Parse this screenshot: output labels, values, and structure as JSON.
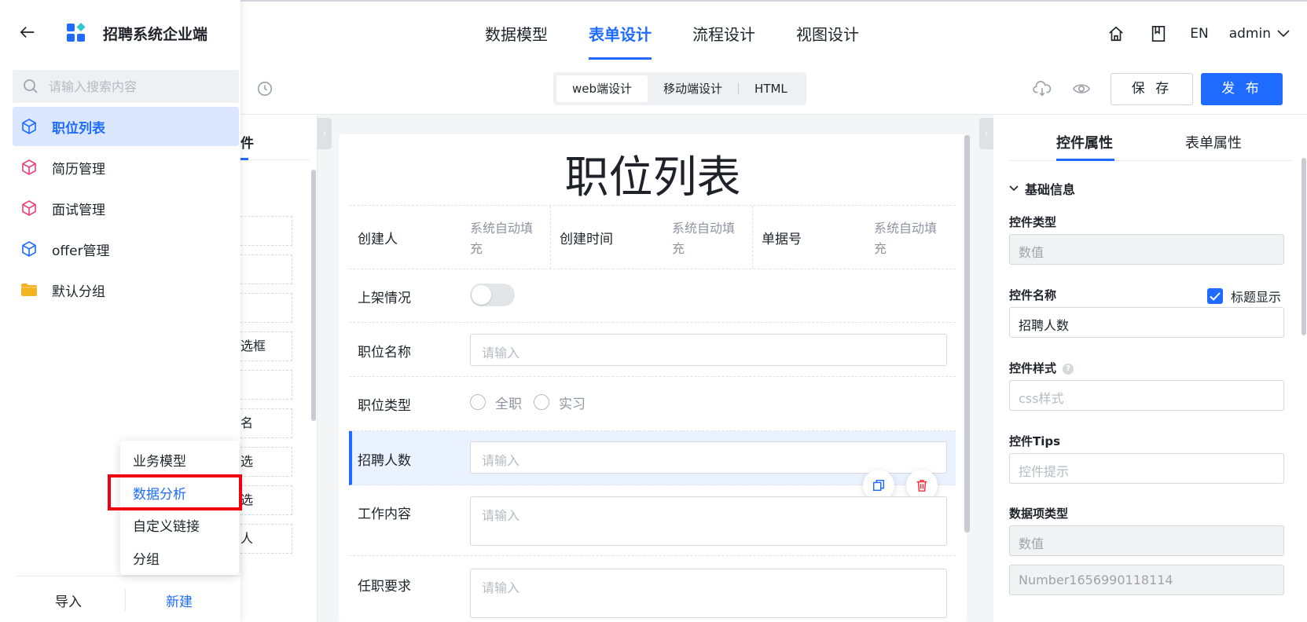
{
  "app": {
    "name": "招聘系统企业端",
    "brand_color": "#1f6bff"
  },
  "header": {
    "tabs": [
      "数据模型",
      "表单设计",
      "流程设计",
      "视图设计"
    ],
    "active_tab": "表单设计",
    "lang": "EN",
    "user": "admin",
    "icons": [
      "home-icon",
      "book-icon"
    ]
  },
  "toolbar": {
    "modes": [
      "web端设计",
      "移动端设计",
      "HTML"
    ],
    "active_mode": "web端设计",
    "save_label": "保 存",
    "publish_label": "发 布",
    "icons": [
      "history-icon",
      "cloud-download-icon",
      "eye-icon"
    ]
  },
  "drawer": {
    "search_placeholder": "请输入搜索内容",
    "items": [
      {
        "label": "职位列表",
        "icon": "cube-icon",
        "color": "#1f6bff",
        "active": true
      },
      {
        "label": "简历管理",
        "icon": "cube-icon",
        "color": "#e8417a",
        "active": false
      },
      {
        "label": "面试管理",
        "icon": "cube-icon",
        "color": "#e8417a",
        "active": false
      },
      {
        "label": "offer管理",
        "icon": "cube-icon",
        "color": "#1f6bff",
        "active": false
      },
      {
        "label": "默认分组",
        "icon": "folder-icon",
        "color": "#f5b323",
        "active": false
      }
    ],
    "footer": {
      "import_label": "导入",
      "new_label": "新建"
    }
  },
  "popup_menu": {
    "items": [
      "业务模型",
      "数据分析",
      "自定义链接",
      "分组"
    ],
    "highlighted": "数据分析",
    "highlight_box_color": "#f0000f"
  },
  "widget_panel": {
    "tab_fragment": "件",
    "cells": [
      "",
      "",
      "",
      "选框",
      "",
      "名",
      "选",
      "选",
      "人"
    ]
  },
  "form": {
    "title": "职位列表",
    "meta": [
      {
        "label": "创建人",
        "value": "系统自动填充"
      },
      {
        "label": "创建时间",
        "value": "系统自动填充"
      },
      {
        "label": "单据号",
        "value": "系统自动填充"
      }
    ],
    "fields": {
      "status_label": "上架情况",
      "name_label": "职位名称",
      "name_placeholder": "请输入",
      "type_label": "职位类型",
      "type_options": [
        "全职",
        "实习"
      ],
      "count_label": "招聘人数",
      "count_placeholder": "请输入",
      "content_label": "工作内容",
      "content_placeholder": "请输入",
      "req_label": "任职要求",
      "req_placeholder": "请输入"
    }
  },
  "right_panel": {
    "tabs": [
      "控件属性",
      "表单属性"
    ],
    "active_tab": "控件属性",
    "section": "基础信息",
    "control_type_label": "控件类型",
    "control_type_value": "数值",
    "control_name_label": "控件名称",
    "show_title_label": "标题显示",
    "show_title_checked": true,
    "control_name_value": "招聘人数",
    "style_label": "控件样式",
    "style_placeholder": "css样式",
    "tips_label": "控件Tips",
    "tips_placeholder": "控件提示",
    "data_type_label": "数据项类型",
    "data_type_value": "数值",
    "field_id": "Number1656990118114"
  }
}
